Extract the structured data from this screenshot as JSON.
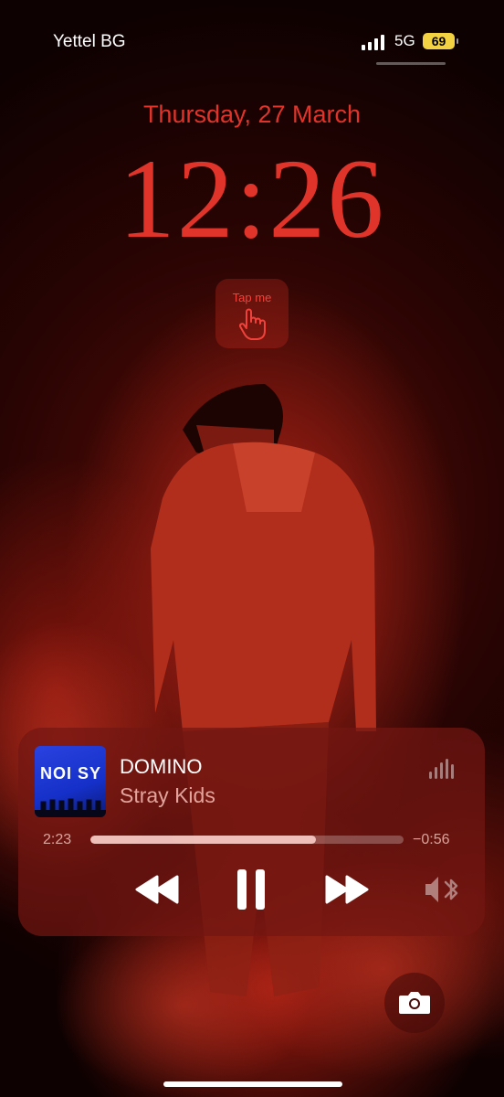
{
  "status_bar": {
    "carrier": "Yettel BG",
    "network": "5G",
    "battery": "69"
  },
  "lock_screen": {
    "date": "Thursday, 27 March",
    "time": "12:26"
  },
  "widget": {
    "label": "Tap me",
    "icon": "pointing-hand-icon"
  },
  "now_playing": {
    "album_art_text": "NOI SY",
    "title": "DOMINO",
    "artist": "Stray Kids",
    "elapsed": "2:23",
    "remaining": "−0:56",
    "progress": 0.72,
    "controls": [
      "rewind-icon",
      "pause-icon",
      "fast-forward-icon",
      "bluetooth-audio-icon"
    ]
  },
  "colors": {
    "accent": "#e0342a",
    "battery": "#f2d143",
    "player_bg": "#731612"
  }
}
